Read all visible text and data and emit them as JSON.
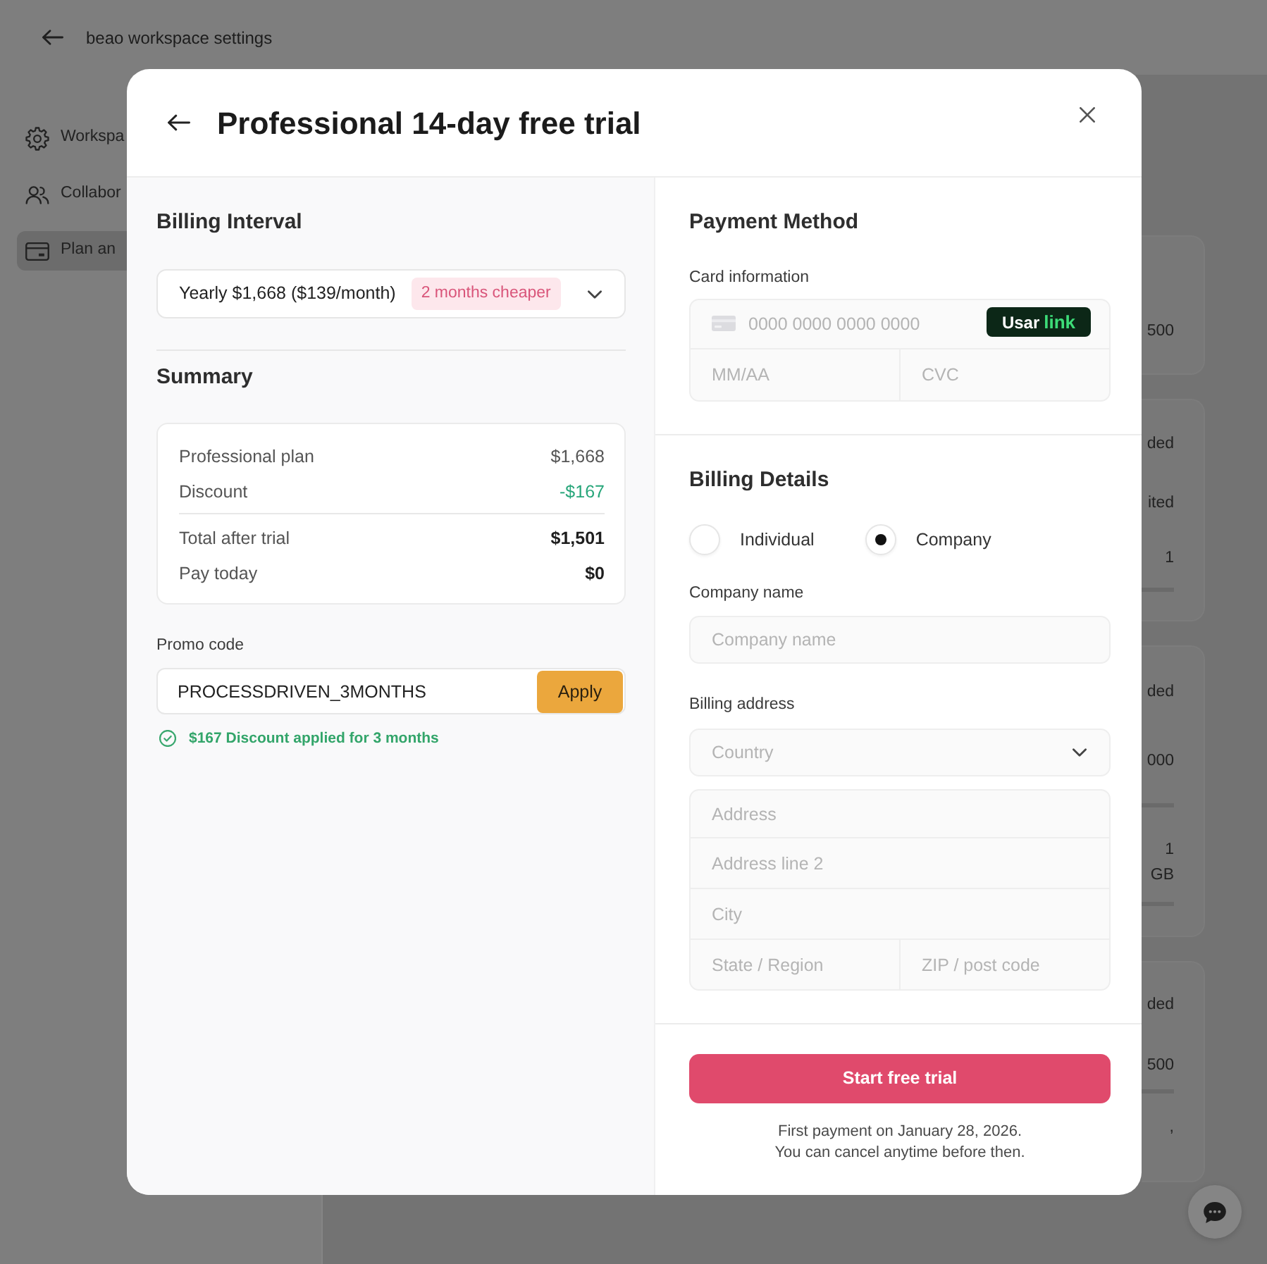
{
  "background_page": {
    "header": {
      "title": "beao workspace settings"
    },
    "sidebar": {
      "items": [
        {
          "label": "Workspa",
          "selected": false
        },
        {
          "label": "Collabor",
          "selected": false
        },
        {
          "label": "Plan an",
          "selected": true
        }
      ]
    },
    "plan_cards": [
      {
        "lines": [
          {
            "kind": "text",
            "text": "500"
          }
        ]
      },
      {
        "lines": [
          {
            "kind": "text",
            "text": "ded"
          },
          {
            "kind": "text",
            "text": "ited"
          },
          {
            "kind": "text",
            "text": "1"
          },
          {
            "kind": "bar"
          }
        ]
      },
      {
        "lines": [
          {
            "kind": "text",
            "text": "ded"
          },
          {
            "kind": "text",
            "text": "000"
          },
          {
            "kind": "bar"
          },
          {
            "kind": "text",
            "text": "1"
          },
          {
            "kind": "text",
            "text": "GB"
          },
          {
            "kind": "bar"
          }
        ]
      },
      {
        "lines": [
          {
            "kind": "text",
            "text": "ded"
          },
          {
            "kind": "text",
            "text": "500"
          },
          {
            "kind": "bar"
          },
          {
            "kind": "text",
            "text": ","
          }
        ]
      }
    ]
  },
  "modal": {
    "title": "Professional 14-day free trial",
    "billing_interval": {
      "heading": "Billing Interval",
      "value": "Yearly $1,668 ($139/month)",
      "badge": "2 months cheaper"
    },
    "summary": {
      "heading": "Summary",
      "rows": [
        {
          "label": "Professional plan",
          "amount": "$1,668",
          "kind": "plain"
        },
        {
          "label": "Discount",
          "amount": "-$167",
          "kind": "discount"
        },
        {
          "label": "Total after trial",
          "amount": "$1,501",
          "kind": "total"
        },
        {
          "label": "Pay today",
          "amount": "$0",
          "kind": "total"
        }
      ]
    },
    "promo": {
      "label": "Promo code",
      "value": "PROCESSDRIVEN_3MONTHS",
      "button": "Apply",
      "message": "$167 Discount applied for 3 months"
    },
    "payment_method": {
      "heading": "Payment Method",
      "card_label": "Card information",
      "card_number_placeholder": "0000 0000 0000 0000",
      "link_button": {
        "label": "Usar",
        "brand": "link"
      },
      "expiry_placeholder": "MM/AA",
      "cvc_placeholder": "CVC"
    },
    "billing_details": {
      "heading": "Billing Details",
      "account_types": [
        {
          "label": "Individual",
          "selected": false
        },
        {
          "label": "Company",
          "selected": true
        }
      ],
      "company_label": "Company name",
      "company_placeholder": "Company name",
      "address_label": "Billing address",
      "country_placeholder": "Country",
      "address_rows": [
        {
          "fields": [
            {
              "placeholder": "Address"
            }
          ]
        },
        {
          "fields": [
            {
              "placeholder": "Address line 2"
            }
          ]
        },
        {
          "fields": [
            {
              "placeholder": "City"
            }
          ]
        },
        {
          "fields": [
            {
              "placeholder": "State / Region"
            },
            {
              "placeholder": "ZIP / post code"
            }
          ]
        }
      ]
    },
    "submit_button": "Start free trial",
    "note_lines": [
      "First payment on January 28, 2026.",
      "You can cancel anytime before then."
    ]
  }
}
